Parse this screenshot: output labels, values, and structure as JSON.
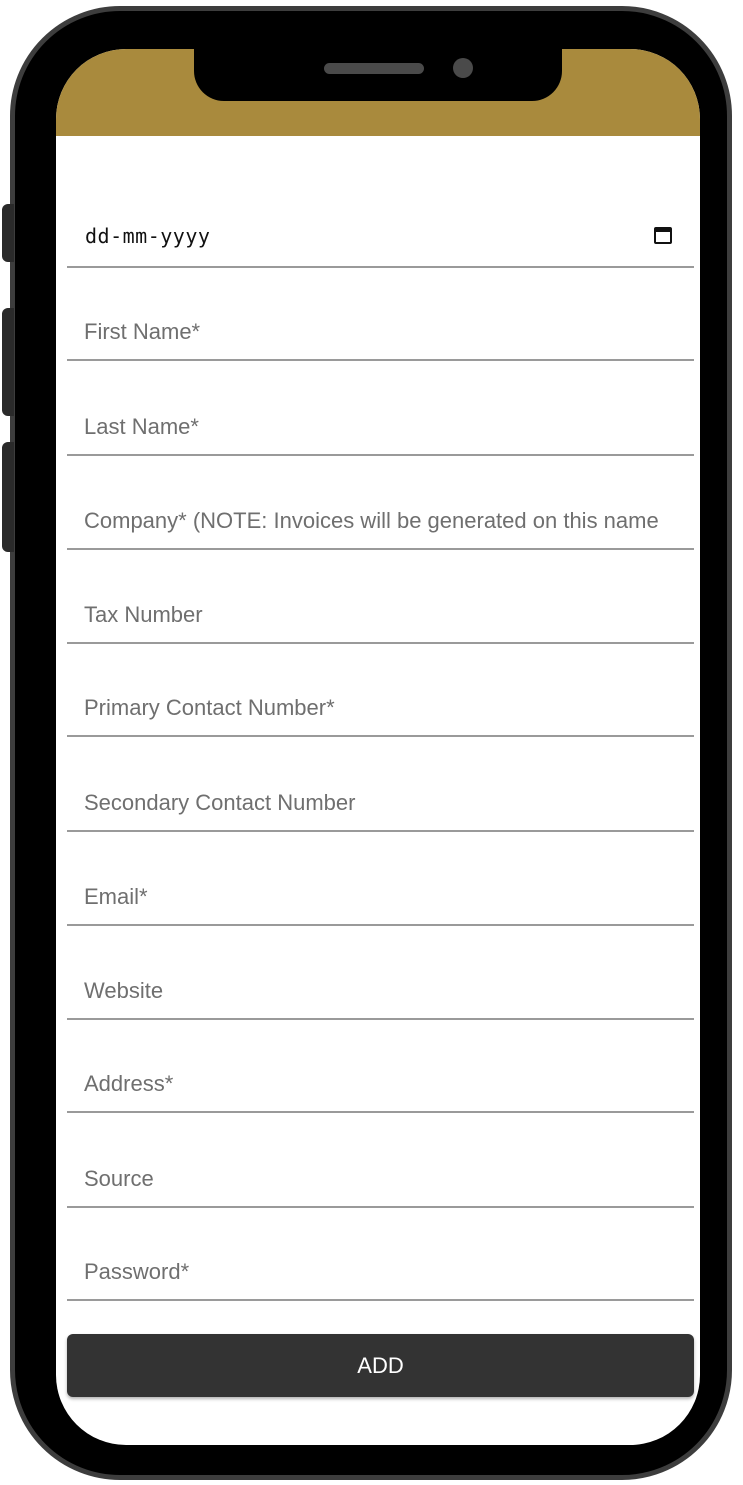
{
  "colors": {
    "header": "#a98a3d",
    "button": "#333333"
  },
  "form": {
    "date_placeholder": "dd-mm-yyyy",
    "fields": [
      "First Name*",
      "Last Name*",
      "Company* (NOTE: Invoices will be generated on this name",
      "Tax Number",
      "Primary Contact Number*",
      "Secondary Contact Number",
      "Email*",
      "Website",
      "Address*",
      "Source",
      "Password*"
    ],
    "submit_label": "ADD"
  },
  "icons": {
    "date": "calendar-icon"
  }
}
